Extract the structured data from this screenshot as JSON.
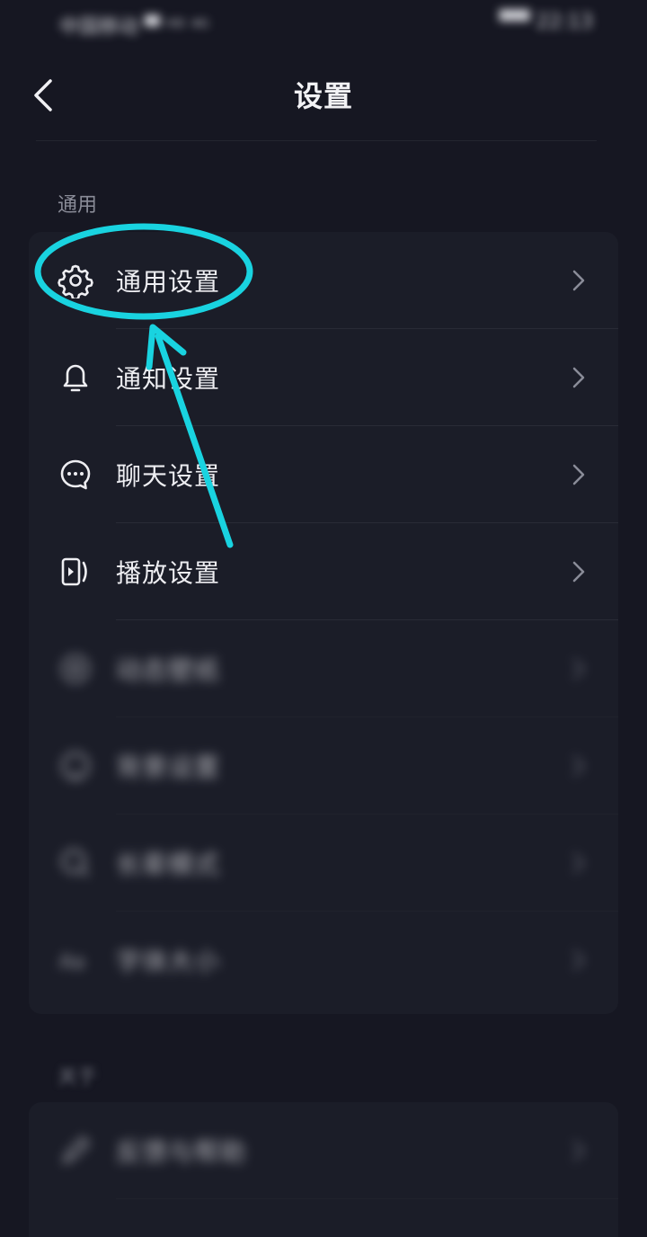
{
  "status_bar": {
    "carrier": "中国移动 ▀ ᴴᴰ ⁴ᴳ",
    "time": "▀▀ 22:13"
  },
  "nav": {
    "title": "设置"
  },
  "sections": [
    {
      "label": "通用",
      "items": [
        {
          "label": "通用设置",
          "icon": "gear-icon"
        },
        {
          "label": "通知设置",
          "icon": "bell-icon"
        },
        {
          "label": "聊天设置",
          "icon": "chat-bubble-icon"
        },
        {
          "label": "播放设置",
          "icon": "play-screen-icon"
        },
        {
          "label": "动态壁纸",
          "icon": "wallpaper-icon"
        },
        {
          "label": "背景设置",
          "icon": "palette-icon"
        },
        {
          "label": "长辈模式",
          "icon": "elder-mode-icon"
        },
        {
          "label": "字体大小",
          "icon": "font-size-icon"
        }
      ]
    },
    {
      "label": "关于",
      "items": [
        {
          "label": "反馈与帮助",
          "icon": "feedback-icon"
        }
      ]
    }
  ],
  "colors": {
    "background": "#161722",
    "card": "#1b1d28",
    "annotation": "#19d3e0"
  }
}
